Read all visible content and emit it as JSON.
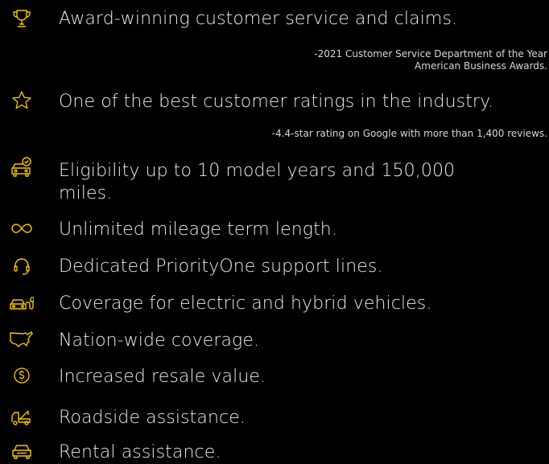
{
  "colors": {
    "accent": "#f6c800",
    "text": "#ececec",
    "background": "#000000"
  },
  "benefits": [
    {
      "icon": "trophy-icon",
      "text": "Award-winning customer service and claims.",
      "note": "-2021 Customer Service Department of the Year",
      "note2": "American Business Awards."
    },
    {
      "icon": "star-icon",
      "text": "One of the best customer ratings in the industry.",
      "note": "-4.4-star rating on Google with more than 1,400 reviews."
    },
    {
      "icon": "car-check-icon",
      "text": "Eligibility up to 10 model years and 150,000 miles."
    },
    {
      "icon": "infinity-icon",
      "text": "Unlimited mileage term length."
    },
    {
      "icon": "headset-icon",
      "text": "Dedicated PriorityOne support lines."
    },
    {
      "icon": "electric-car-icon",
      "text": "Coverage for electric and hybrid vehicles."
    },
    {
      "icon": "us-map-icon",
      "text": "Nation-wide coverage."
    },
    {
      "icon": "dollar-coin-icon",
      "text": "Increased resale value."
    },
    {
      "icon": "tow-truck-icon",
      "text": "Roadside assistance."
    },
    {
      "icon": "car-icon",
      "text": "Rental assistance."
    }
  ]
}
